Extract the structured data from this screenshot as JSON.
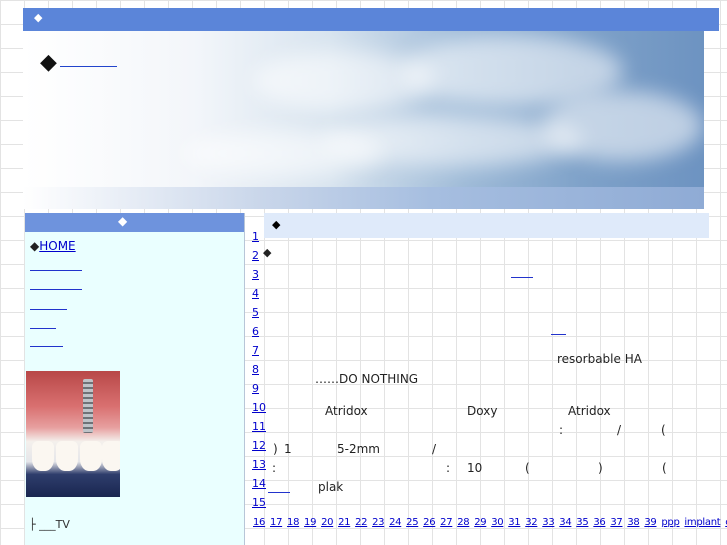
{
  "header": {
    "top_diamond": "◆",
    "banner_diamond": "◆"
  },
  "sidebar": {
    "head_diamond": "◆",
    "home_diamond": "◆",
    "home_label": "HOME",
    "bottom_note": "TV"
  },
  "main": {
    "head_diamond": "◆",
    "body_diamond": "◆",
    "row_numbers": [
      "1",
      "2",
      "3",
      "4",
      "5",
      "6",
      "7",
      "8",
      "9",
      "10",
      "11",
      "12",
      "13",
      "14",
      "15"
    ],
    "texts": {
      "resorbable": "resorbable HA",
      "do_nothing": "……DO NOTHING",
      "atridox_1": "Atridox",
      "doxy": "Doxy",
      "atridox_2": "Atridox",
      "colon_1": ":",
      "slash_1": "/",
      "paren_1": "(",
      "paren_close_1": ")",
      "one": "1",
      "two_mm": "5-2mm",
      "slash_2": "/",
      "colon_2": ":",
      "colon_3": ":",
      "ten": "10",
      "paren_2": "(",
      "paren_close_2": ")",
      "paren_3": "(",
      "plak": "plak"
    },
    "bottom_links": [
      "16",
      "17",
      "18",
      "19",
      "20",
      "21",
      "22",
      "23",
      "24",
      "25",
      "26",
      "27",
      "28",
      "29",
      "30",
      "31",
      "32",
      "33",
      "34",
      "35",
      "36",
      "37",
      "38",
      "39",
      "ppp",
      "implant",
      "cavity"
    ]
  }
}
